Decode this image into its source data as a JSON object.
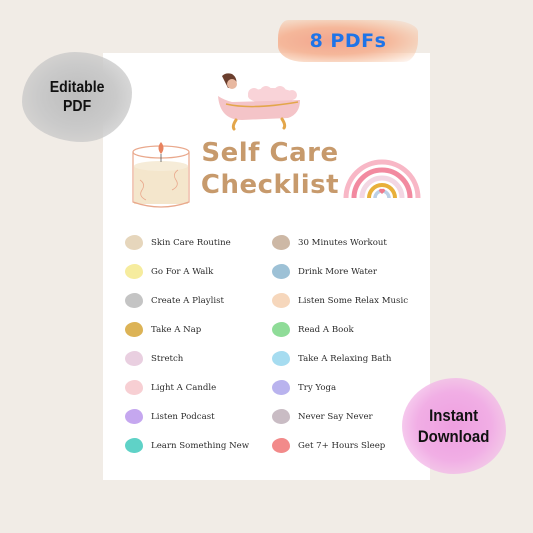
{
  "badges": {
    "pdf_count": "8 PDFs",
    "editable_line1": "Editable",
    "editable_line2": "PDF",
    "instant_line1": "Instant",
    "instant_line2": "Download"
  },
  "title": {
    "line1": "Self Care",
    "line2": "Checklist"
  },
  "illustrations": [
    "bathtub-icon",
    "candle-icon",
    "rainbow-icon"
  ],
  "checklist": {
    "left": [
      {
        "label": "Skin Care Routine",
        "color": "#e6d6bc"
      },
      {
        "label": "Go For A Walk",
        "color": "#f6ec9e"
      },
      {
        "label": "Create A Playlist",
        "color": "#c4c4c4"
      },
      {
        "label": "Take A Nap",
        "color": "#dcb356"
      },
      {
        "label": "Stretch",
        "color": "#e9cfe0"
      },
      {
        "label": "Light A Candle",
        "color": "#f7cfd3"
      },
      {
        "label": "Listen Podcast",
        "color": "#c5a7ef"
      },
      {
        "label": "Learn Something New",
        "color": "#5fd2c7"
      }
    ],
    "right": [
      {
        "label": "30 Minutes Workout",
        "color": "#cdb8a5"
      },
      {
        "label": "Drink More Water",
        "color": "#9dc1d6"
      },
      {
        "label": "Listen Some Relax Music",
        "color": "#f6d7bc"
      },
      {
        "label": "Read A Book",
        "color": "#8fdc98"
      },
      {
        "label": "Take A Relaxing Bath",
        "color": "#a6dcf0"
      },
      {
        "label": "Try Yoga",
        "color": "#b9b3ee"
      },
      {
        "label": "Never Say Never",
        "color": "#c9bcc4"
      },
      {
        "label": "Get 7+ Hours Sleep",
        "color": "#f28a8a"
      }
    ]
  }
}
